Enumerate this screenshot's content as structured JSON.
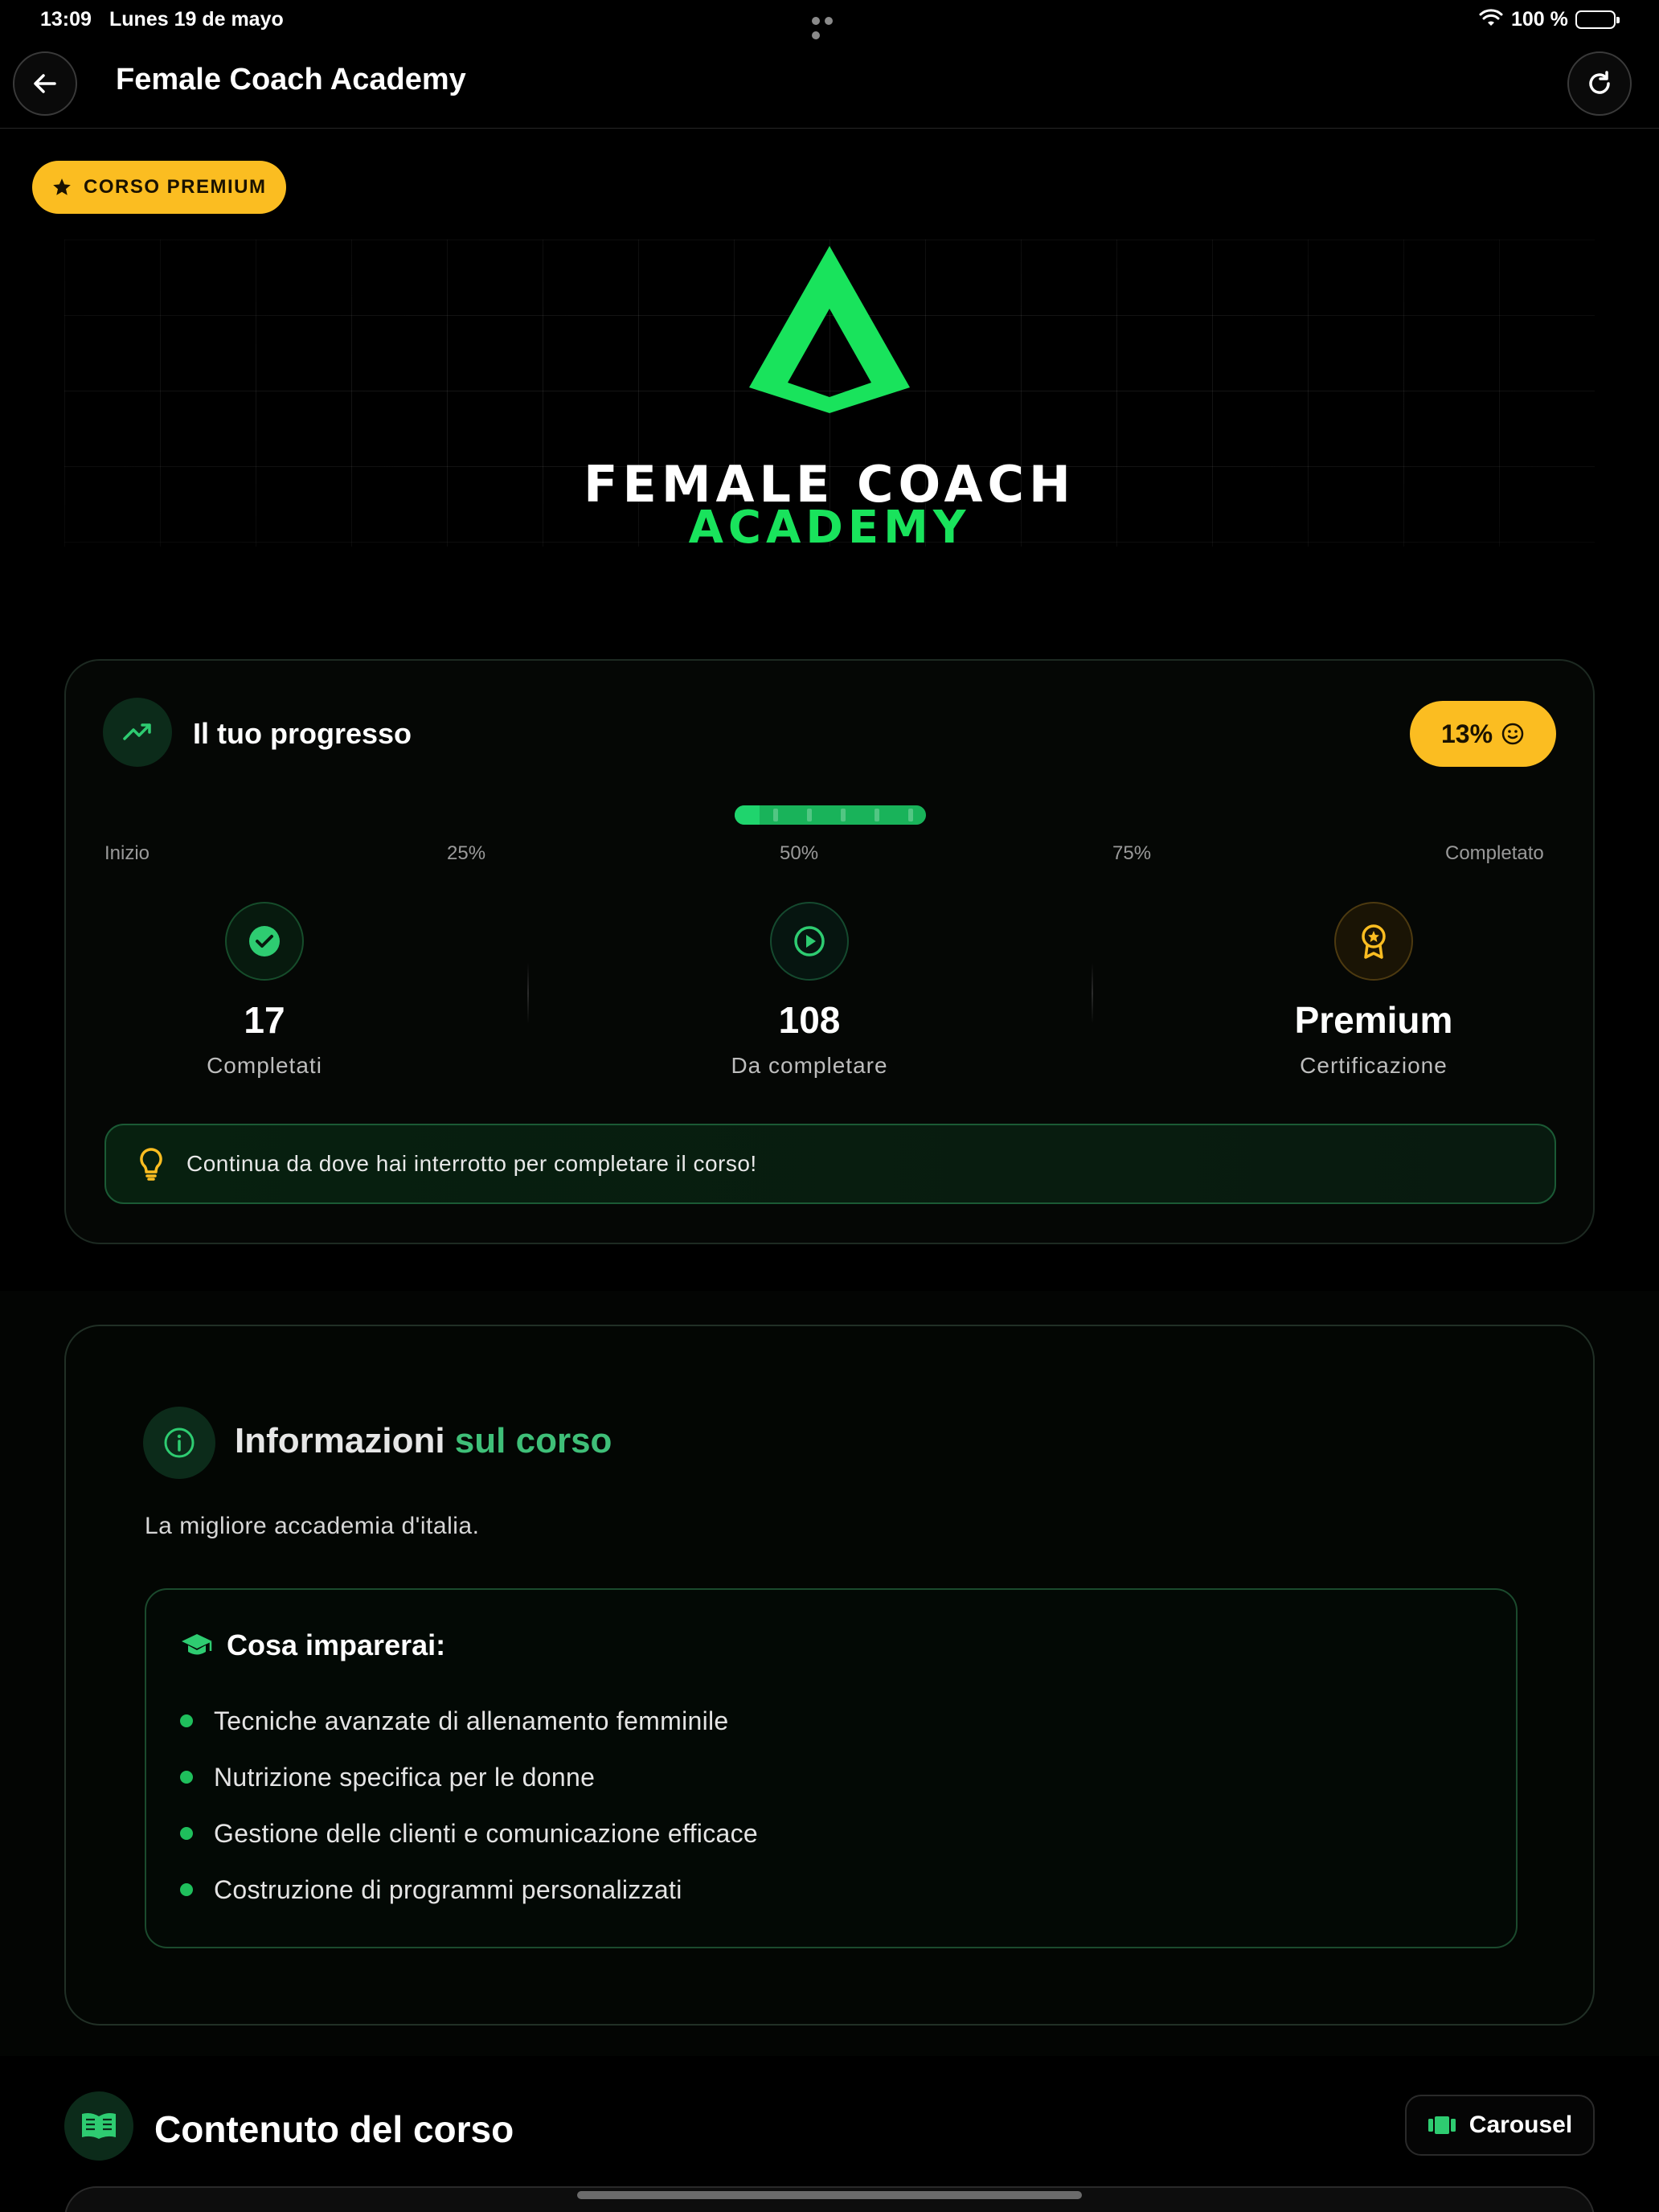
{
  "status_bar": {
    "time": "13:09",
    "date": "Lunes 19 de mayo",
    "battery": "100 %"
  },
  "nav": {
    "title": "Female Coach Academy"
  },
  "badge": {
    "label": "CORSO PREMIUM"
  },
  "logo": {
    "line1": "FEMALE COACH",
    "line2": "ACADEMY"
  },
  "progress": {
    "title": "Il tuo progresso",
    "percent_label": "13%",
    "percent_value": 13,
    "milestones": [
      "Inizio",
      "25%",
      "50%",
      "75%",
      "Completato"
    ],
    "stats": [
      {
        "value": "17",
        "label": "Completati",
        "icon": "check-circle-icon"
      },
      {
        "value": "108",
        "label": "Da completare",
        "icon": "play-circle-icon"
      },
      {
        "value": "Premium",
        "label": "Certificazione",
        "icon": "award-icon"
      }
    ],
    "tip": "Continua da dove hai interrotto per completare il corso!"
  },
  "info": {
    "title_part1": "Informazioni",
    "title_part2": "sul corso",
    "description": "La migliore accademia d'italia.",
    "learn_title": "Cosa imparerai:",
    "learn_items": [
      "Tecniche avanzate di allenamento femminile",
      "Nutrizione specifica per le donne",
      "Gestione delle clienti e comunicazione efficace",
      "Costruzione di programmi personalizzati"
    ]
  },
  "content": {
    "title": "Contenuto del corso",
    "view_button": "Carousel"
  },
  "colors": {
    "accent_green": "#19e35c",
    "premium_yellow": "#fbbd21",
    "background": "#000000"
  }
}
